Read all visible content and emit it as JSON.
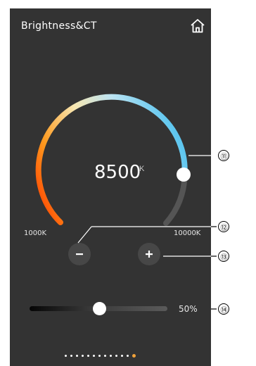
{
  "header": {
    "title": "Brightness&CT",
    "home_icon": "home-icon"
  },
  "color_temperature": {
    "value": "8500",
    "unit": "K",
    "min_label": "1000K",
    "max_label": "10000K",
    "min": 1000,
    "max": 10000,
    "current": 8500
  },
  "controls": {
    "minus_icon": "minus-icon",
    "plus_icon": "plus-icon"
  },
  "brightness": {
    "percent_label": "50%",
    "value": 0.5
  },
  "pagination": {
    "total": 13,
    "active_index": 12
  },
  "callouts": [
    "⑪",
    "⑫",
    "⑬",
    "⑭"
  ],
  "colors": {
    "panel_bg": "#333333",
    "arc_gradient": [
      "#ff4500",
      "#ffb02a",
      "#f7e9b8",
      "#bfe6f2",
      "#5fc8f0"
    ],
    "arc_remaining": "#555555",
    "active_dot": "#f0a23a"
  }
}
